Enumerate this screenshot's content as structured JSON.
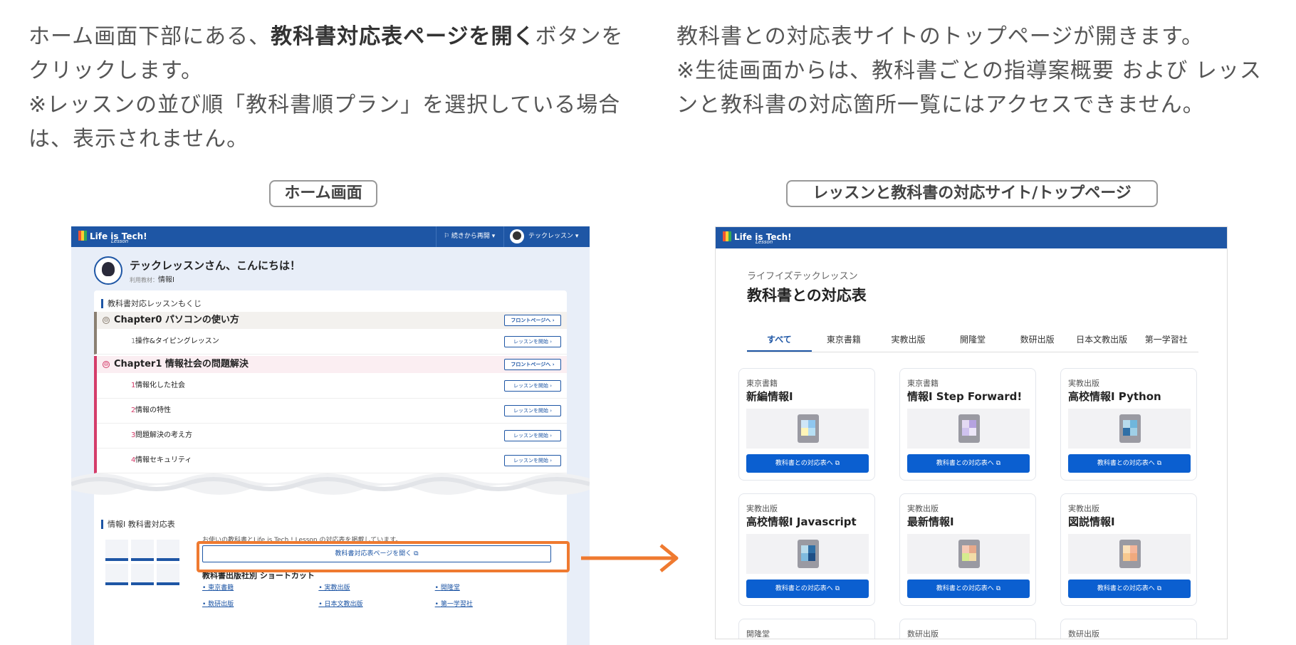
{
  "left_desc": {
    "line1_pre": "ホーム画面下部にある、",
    "line1_bold": "教科書対応表ページを開く",
    "line1_post": "ボタンをクリックします。",
    "line2": "※レッスンの並び順「教科書順プラン」を選択している場合は、表示されません。"
  },
  "right_desc": {
    "line1": "教科書との対応表サイトのトップページが開きます。",
    "line2": "※生徒画面からは、教科書ごとの指導案概要 および レッスンと教科書の対応箇所一覧にはアクセスできません。"
  },
  "captions": {
    "left": "ホーム画面",
    "right": "レッスンと教科書の対応サイト/トップページ"
  },
  "app": {
    "logo": "Life is Tech!",
    "logo_sub": "Lesson",
    "resume": "⚐ 続きから再開 ▾",
    "user": "テックレッスン ▾"
  },
  "home": {
    "greeting": "テックレッスンさん、こんにちは！",
    "material_label": "利用教材：",
    "material": "情報Ⅰ",
    "toc_title": "教科書対応レッスンもくじ",
    "rows": [
      {
        "kind": "chap",
        "label": "Chapter0  パソコンの使い方",
        "btn": "フロントページへ ›",
        "color": "#8a7f72",
        "bg": "#f3f1ee"
      },
      {
        "kind": "les",
        "num": "1",
        "label": "操作&タイピングレッスン",
        "btn": "レッスンを開始 ›",
        "color": "#8a7f72"
      },
      {
        "kind": "chap",
        "label": "Chapter1  情報社会の問題解決",
        "btn": "フロントページへ ›",
        "color": "#d43c6a",
        "bg": "#fbeef2"
      },
      {
        "kind": "les",
        "num": "1",
        "label": "情報化した社会",
        "btn": "レッスンを開始 ›",
        "color": "#d43c6a"
      },
      {
        "kind": "les",
        "num": "2",
        "label": "情報の特性",
        "btn": "レッスンを開始 ›",
        "color": "#d43c6a"
      },
      {
        "kind": "les",
        "num": "3",
        "label": "問題解決の考え方",
        "btn": "レッスンを開始 ›",
        "color": "#d43c6a"
      },
      {
        "kind": "les",
        "num": "4",
        "label": "情報セキュリティ",
        "btn": "レッスンを開始 ›",
        "color": "#d43c6a"
      }
    ],
    "section_title": "情報Ⅰ 教科書対応表",
    "section_note": "お使いの教科書とLife is Tech ! Lesson の対応表を掲載しています。",
    "open_button": "教科書対応表ページを開く ⧉",
    "shortcut_title": "教科書出版社別 ショートカット",
    "shortcuts": [
      "東京書籍",
      "実教出版",
      "開隆堂",
      "数研出版",
      "日本文教出版",
      "第一学習社"
    ]
  },
  "site": {
    "subtitle": "ライフイズテックレッスン",
    "title": "教科書との対応表",
    "tabs": [
      "すべて",
      "東京書籍",
      "実教出版",
      "開隆堂",
      "数研出版",
      "日本文教出版",
      "第一学習社"
    ],
    "active_tab": "すべて",
    "card_button": "教科書との対応表へ ⧉",
    "cards": [
      {
        "pub": "東京書籍",
        "name": "新編情報Ⅰ",
        "colors": [
          "#cfe6f7",
          "#8fc7ef",
          "#fff5b8",
          "#b7e0f5"
        ]
      },
      {
        "pub": "東京書籍",
        "name": "情報Ⅰ Step Forward!",
        "colors": [
          "#e3d9f3",
          "#b5a2e0",
          "#cfc2ee",
          "#ece6f8"
        ]
      },
      {
        "pub": "実教出版",
        "name": "高校情報Ⅰ Python",
        "colors": [
          "#b8dbec",
          "#6fb6dc",
          "#2f6fa6",
          "#9fcfe6"
        ]
      },
      {
        "pub": "実教出版",
        "name": "高校情報Ⅰ Javascript",
        "colors": [
          "#b8dbec",
          "#2f6fa6",
          "#7fbbdf",
          "#1e4f86"
        ]
      },
      {
        "pub": "実教出版",
        "name": "最新情報Ⅰ",
        "colors": [
          "#f5c9b5",
          "#e7a98a",
          "#d6ec8e",
          "#f3dca7"
        ]
      },
      {
        "pub": "実教出版",
        "name": "図説情報Ⅰ",
        "colors": [
          "#fbe0b8",
          "#f4b69a",
          "#f7c98f",
          "#f0a97e"
        ]
      },
      {
        "pub": "開隆堂",
        "name": ""
      },
      {
        "pub": "数研出版",
        "name": ""
      },
      {
        "pub": "数研出版",
        "name": ""
      }
    ]
  },
  "colors": {
    "brand": "#1e56a5",
    "highlight": "#ef7a30",
    "card_button": "#0b5fd0"
  }
}
